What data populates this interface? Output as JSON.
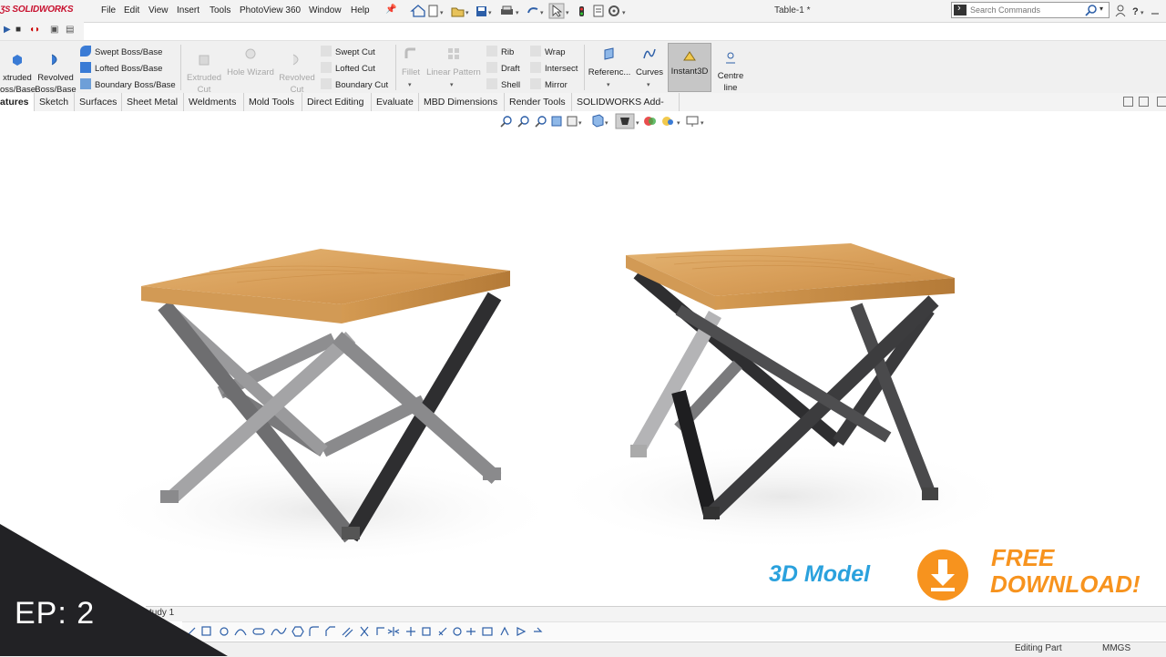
{
  "app": {
    "logo_text": "SOLIDWORKS",
    "document_title": "Table-1 *"
  },
  "menu": [
    "File",
    "Edit",
    "View",
    "Insert",
    "Tools",
    "PhotoView 360",
    "Window",
    "Help"
  ],
  "search": {
    "placeholder": "Search Commands"
  },
  "ribbon": {
    "extruded_boss": "Extruded Boss/Base",
    "extruded_boss_l1": "xtruded",
    "extruded_boss_l2": "oss/Base",
    "revolved_boss_l1": "Revolved",
    "revolved_boss_l2": "Boss/Base",
    "swept_boss": "Swept Boss/Base",
    "lofted_boss": "Lofted Boss/Base",
    "boundary_boss": "Boundary Boss/Base",
    "extruded_cut_l1": "Extruded",
    "extruded_cut_l2": "Cut",
    "hole_wizard": "Hole Wizard",
    "revolved_cut_l1": "Revolved",
    "revolved_cut_l2": "Cut",
    "swept_cut": "Swept Cut",
    "lofted_cut": "Lofted Cut",
    "boundary_cut": "Boundary Cut",
    "fillet": "Fillet",
    "linear_pattern": "Linear Pattern",
    "rib": "Rib",
    "draft": "Draft",
    "shell": "Shell",
    "wrap": "Wrap",
    "intersect": "Intersect",
    "mirror": "Mirror",
    "reference": "Referenc...",
    "curves": "Curves",
    "instant3d": "Instant3D",
    "centreline_l1": "Centre",
    "centreline_l2": "line"
  },
  "tabs": [
    "atures",
    "Sketch",
    "Surfaces",
    "Sheet Metal",
    "Weldments",
    "Mold Tools",
    "Direct Editing",
    "Evaluate",
    "MBD Dimensions",
    "Render Tools",
    "SOLIDWORKS Add-Ins"
  ],
  "bottom": {
    "study_tab": "tudy 1"
  },
  "status": {
    "editing": "Editing Part",
    "units": "MMGS"
  },
  "overlay": {
    "episode": "EP: 2",
    "promo_3d": "3D Model",
    "promo_free": "FREE",
    "promo_download": "DOWNLOAD!"
  },
  "colors": {
    "accent_blue": "#2aa1dd",
    "accent_orange": "#f7931e",
    "wood": "#d9a05b",
    "steel": "#6e6e70",
    "brand_red": "#c8102e"
  },
  "icons": [
    "home-icon",
    "new-file-icon",
    "open-icon",
    "save-icon",
    "print-icon",
    "undo-icon",
    "select-icon",
    "rebuild-icon",
    "file-properties-icon",
    "options-icon",
    "user-icon",
    "help-icon",
    "download-icon"
  ]
}
